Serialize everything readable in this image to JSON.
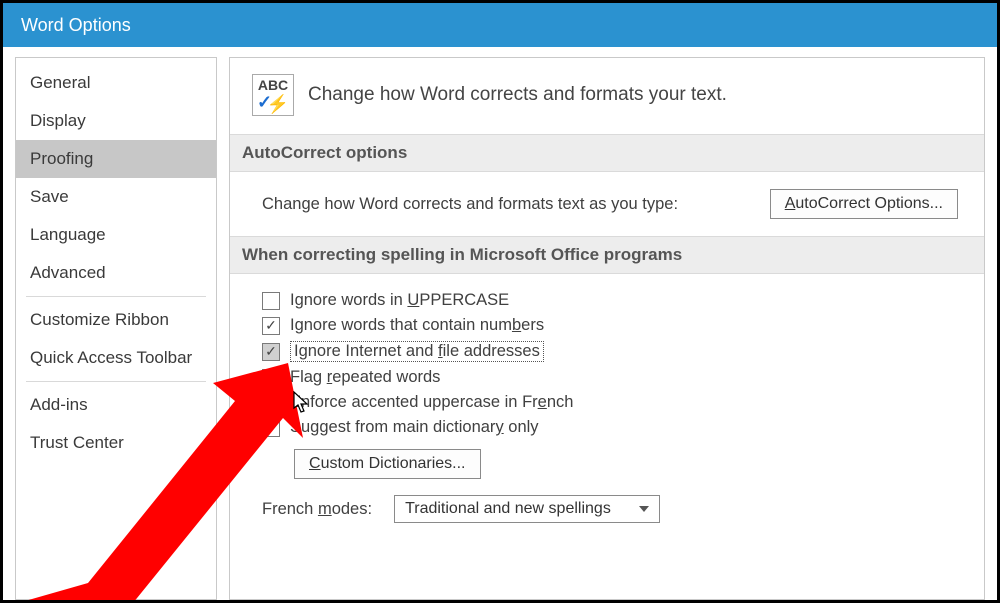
{
  "window": {
    "title": "Word Options"
  },
  "sidebar": {
    "items": [
      {
        "label": "General"
      },
      {
        "label": "Display"
      },
      {
        "label": "Proofing",
        "selected": true
      },
      {
        "label": "Save"
      },
      {
        "label": "Language"
      },
      {
        "label": "Advanced"
      },
      {
        "divider": true
      },
      {
        "label": "Customize Ribbon"
      },
      {
        "label": "Quick Access Toolbar"
      },
      {
        "divider": true
      },
      {
        "label": "Add-ins"
      },
      {
        "label": "Trust Center"
      }
    ]
  },
  "main": {
    "abc_icon_label": "ABC",
    "intro": "Change how Word corrects and formats your text.",
    "section_autocorrect": "AutoCorrect options",
    "autocorrect_desc": "Change how Word corrects and formats text as you type:",
    "autocorrect_button": "AutoCorrect Options...",
    "autocorrect_button_mn": "A",
    "section_spelling": "When correcting spelling in Microsoft Office programs",
    "checks": [
      {
        "label_pre": "Ignore words in ",
        "mn": "U",
        "label_post": "PPERCASE",
        "checked": false
      },
      {
        "label_pre": "Ignore words that contain num",
        "mn": "b",
        "label_post": "ers",
        "checked": true
      },
      {
        "label_pre": "Ignore Internet and ",
        "mn": "f",
        "label_post": "ile addresses",
        "checked": true,
        "focused": true,
        "grey": true
      },
      {
        "label_pre": "Flag ",
        "mn": "r",
        "label_post": "epeated words",
        "checked": true
      },
      {
        "label_pre": "Enforce accented uppercase in Fr",
        "mn": "e",
        "label_post": "nch",
        "checked": false
      },
      {
        "label_pre": "Suggest from main dictionar",
        "mn": "y",
        "label_post": " only",
        "checked": false
      }
    ],
    "custom_dict_button": "Custom Dictionaries...",
    "custom_dict_mn": "C",
    "french_label_pre": "French ",
    "french_mn": "m",
    "french_label_post": "odes:",
    "french_value": "Traditional and new spellings"
  }
}
